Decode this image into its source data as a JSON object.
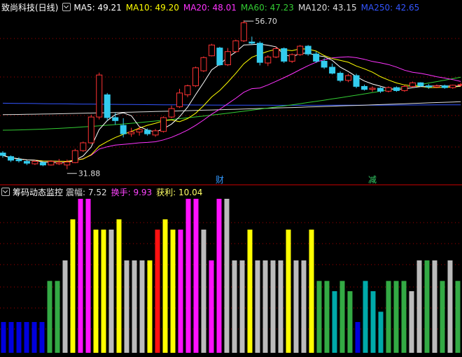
{
  "stock": {
    "title": "致尚科技(日线)"
  },
  "ma_legend": [
    {
      "label": "MA5: 49.21",
      "color": "#ffffff"
    },
    {
      "label": "MA10: 49.20",
      "color": "#ffff00"
    },
    {
      "label": "MA20: 48.01",
      "color": "#ff33ff"
    },
    {
      "label": "MA60: 47.23",
      "color": "#33cc33"
    },
    {
      "label": "MA120: 43.15",
      "color": "#dddddd"
    },
    {
      "label": "MA250: 42.65",
      "color": "#3355ff"
    }
  ],
  "price_annotations": {
    "high": "56.70",
    "low": "31.88"
  },
  "event_markers": [
    {
      "label": "财",
      "color": "#3399ff"
    },
    {
      "label": "减",
      "color": "#33cc66"
    }
  ],
  "indicator": {
    "title": "筹码动态监控",
    "fields": [
      {
        "label": "震幅: 7.52",
        "color": "#dddddd"
      },
      {
        "label": "换手: 9.93",
        "color": "#ff44ff"
      },
      {
        "label": "获利: 10.04",
        "color": "#ffff66"
      }
    ]
  },
  "colors": {
    "up": "#ff3333",
    "down": "#33ccee",
    "ma5": "#ffffff",
    "ma10": "#ffff00",
    "ma20": "#ff33ff",
    "ma60": "#33cc33",
    "ma120": "#dddddd",
    "ma250": "#3355ff",
    "grid": "#aa0000",
    "bar": {
      "blue": "#0000dd",
      "green": "#33aa44",
      "gray": "#bbbbbb",
      "yellow": "#ffff00",
      "magenta": "#ff11ff",
      "red": "#ff1111",
      "cyan": "#00aaaa"
    }
  },
  "chart_data": [
    {
      "type": "candlestick",
      "title": "致尚科技(日线)",
      "price_range": [
        30,
        58
      ],
      "candles": [
        [
          34.6,
          34.9,
          33.8,
          34.2
        ],
        [
          34.0,
          34.2,
          33.1,
          33.4
        ],
        [
          33.5,
          33.9,
          33.0,
          33.3
        ],
        [
          33.2,
          33.4,
          32.6,
          32.9
        ],
        [
          32.8,
          33.4,
          32.6,
          33.2
        ],
        [
          33.0,
          33.2,
          32.4,
          32.6
        ],
        [
          32.6,
          33.4,
          32.5,
          33.2
        ],
        [
          32.8,
          33.6,
          32.6,
          33.0
        ],
        [
          32.6,
          33.5,
          31.9,
          33.1
        ],
        [
          33.0,
          35.3,
          32.9,
          35.0
        ],
        [
          35.0,
          36.5,
          34.8,
          36.3
        ],
        [
          36.3,
          41.0,
          36.1,
          40.6
        ],
        [
          40.6,
          48.0,
          40.2,
          47.6
        ],
        [
          44.3,
          44.6,
          40.0,
          40.5
        ],
        [
          40.5,
          41.3,
          39.3,
          40.0
        ],
        [
          39.2,
          40.4,
          37.2,
          37.8
        ],
        [
          37.8,
          38.8,
          37.3,
          38.1
        ],
        [
          38.1,
          39.0,
          37.5,
          38.5
        ],
        [
          38.4,
          38.7,
          37.5,
          37.8
        ],
        [
          37.6,
          38.6,
          37.3,
          38.3
        ],
        [
          38.2,
          40.7,
          38.0,
          40.5
        ],
        [
          40.6,
          42.5,
          40.4,
          42.0
        ],
        [
          42.3,
          45.3,
          42.1,
          44.6
        ],
        [
          44.3,
          46.0,
          43.9,
          45.8
        ],
        [
          45.8,
          49.0,
          45.6,
          48.8
        ],
        [
          48.3,
          50.7,
          48.1,
          50.5
        ],
        [
          50.8,
          52.8,
          50.7,
          52.6
        ],
        [
          52.1,
          52.3,
          49.1,
          49.3
        ],
        [
          49.3,
          52.1,
          49.1,
          51.5
        ],
        [
          51.5,
          53.5,
          51.3,
          53.3
        ],
        [
          53.3,
          56.7,
          53.1,
          56.3
        ],
        [
          53.1,
          54.0,
          52.6,
          52.9
        ],
        [
          52.9,
          53.2,
          49.2,
          49.7
        ],
        [
          49.6,
          50.9,
          49.1,
          50.6
        ],
        [
          50.6,
          52.3,
          50.4,
          52.0
        ],
        [
          52.0,
          52.2,
          49.6,
          49.9
        ],
        [
          49.9,
          51.2,
          49.6,
          51.0
        ],
        [
          51.0,
          52.6,
          50.8,
          52.4
        ],
        [
          52.4,
          52.6,
          50.8,
          51.1
        ],
        [
          51.1,
          51.5,
          49.6,
          49.9
        ],
        [
          49.9,
          50.4,
          48.6,
          48.9
        ],
        [
          48.9,
          49.5,
          47.7,
          47.9
        ],
        [
          47.9,
          48.2,
          46.4,
          46.7
        ],
        [
          46.7,
          47.8,
          46.4,
          47.5
        ],
        [
          47.5,
          47.8,
          45.4,
          45.7
        ],
        [
          45.7,
          46.0,
          45.0,
          45.2
        ],
        [
          45.2,
          45.7,
          44.8,
          45.4
        ],
        [
          45.4,
          45.6,
          44.6,
          44.9
        ],
        [
          44.9,
          45.7,
          44.7,
          45.5
        ],
        [
          45.5,
          45.7,
          44.8,
          45.0
        ],
        [
          45.0,
          45.9,
          44.8,
          45.7
        ],
        [
          45.7,
          46.5,
          45.5,
          46.3
        ],
        [
          46.3,
          46.4,
          45.6,
          45.8
        ],
        [
          45.8,
          46.1,
          45.3,
          45.6
        ],
        [
          45.6,
          46.0,
          45.4,
          45.8
        ],
        [
          45.8,
          46.0,
          45.3,
          45.5
        ],
        [
          45.5,
          46.0,
          45.3,
          45.9
        ],
        [
          45.9,
          46.3,
          45.7,
          46.0
        ]
      ]
    },
    {
      "type": "bar",
      "title": "筹码动态监控",
      "heights": [
        3,
        3,
        3,
        3,
        3,
        3,
        7,
        7,
        9,
        13,
        15,
        15,
        12,
        12,
        12,
        13,
        9,
        9,
        9,
        9,
        12,
        13,
        12,
        12,
        15,
        15,
        12,
        9,
        15,
        15,
        9,
        9,
        12,
        9,
        9,
        9,
        9,
        12,
        9,
        9,
        12,
        7,
        7,
        6,
        7,
        6,
        3,
        7,
        6,
        4,
        7,
        7,
        7,
        6,
        9,
        9,
        9,
        7,
        9,
        7
      ],
      "colors": [
        "blue",
        "blue",
        "blue",
        "blue",
        "blue",
        "blue",
        "green",
        "green",
        "gray",
        "yellow",
        "magenta",
        "magenta",
        "yellow",
        "yellow",
        "gray",
        "yellow",
        "gray",
        "gray",
        "gray",
        "yellow",
        "red",
        "yellow",
        "yellow",
        "magenta",
        "magenta",
        "magenta",
        "gray",
        "magenta",
        "magenta",
        "gray",
        "gray",
        "gray",
        "yellow",
        "gray",
        "gray",
        "gray",
        "gray",
        "yellow",
        "gray",
        "gray",
        "yellow",
        "green",
        "green",
        "cyan",
        "green",
        "green",
        "blue",
        "cyan",
        "cyan",
        "cyan",
        "green",
        "green",
        "green",
        "gray",
        "gray",
        "green",
        "gray",
        "green",
        "gray",
        "green"
      ]
    }
  ]
}
